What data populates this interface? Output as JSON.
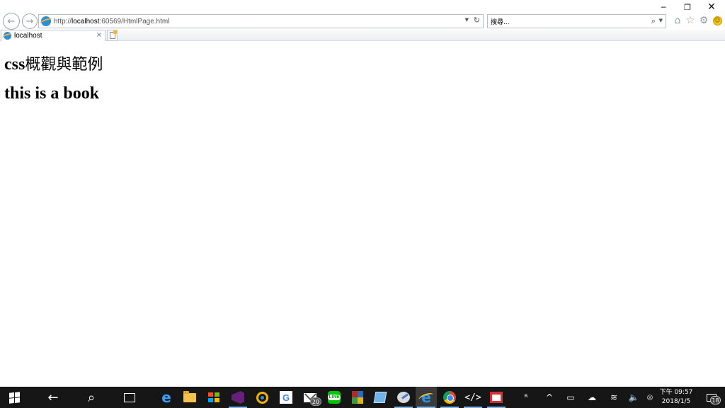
{
  "window": {
    "minimize": "─",
    "restore": "❐",
    "close": "✕"
  },
  "nav": {
    "back": "←",
    "forward": "→"
  },
  "address": {
    "prefix": "http://",
    "host": "localhost",
    "suffix": ":60569/HtmlPage.html",
    "dropdown": "▼",
    "refresh": "↻"
  },
  "search": {
    "placeholder": "搜尋...",
    "icon": "⌕",
    "dropdown": "▼"
  },
  "toolbar": {
    "home": "⌂",
    "favorites": "☆",
    "settings": "⚙",
    "feedback": "☺"
  },
  "tab": {
    "label": "localhost",
    "close": "×"
  },
  "page": {
    "heading1_latin": "css",
    "heading1_cjk": "概觀與範例",
    "heading2": "this is a book"
  },
  "taskbar": {
    "back": "←",
    "search": "⌕",
    "mail_badge": "20",
    "vision": "ᴿ",
    "chevron": "^",
    "battery": "▭",
    "cloud": "☁",
    "wifi": "≋",
    "volume": "🔈",
    "close_circle": "⊗",
    "clock_time": "下午 09:57",
    "clock_date": "2018/1/5",
    "notification_count": "18"
  }
}
